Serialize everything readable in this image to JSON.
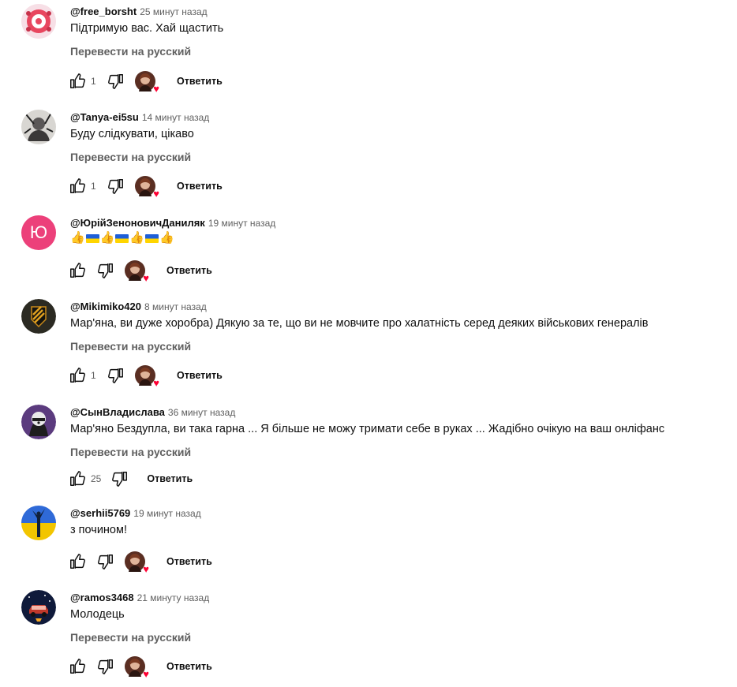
{
  "colors": {
    "text": "#0f0f0f",
    "secondary": "#606060",
    "heart": "#ff0033",
    "letter_avatar_bg": "#ec407a"
  },
  "reply_label": "Ответить",
  "translate_label": "Перевести на русский",
  "comments": [
    {
      "author": "@free_borsht",
      "time": "25 минут назад",
      "text": "Підтримую вас. Хай щастить",
      "likes": "1",
      "translate": true,
      "avatar_icon": "pink-roses-icon"
    },
    {
      "author": "@Tanya-ei5su",
      "time": "14 минут назад",
      "text": "Буду слідкувати, цікаво",
      "likes": "1",
      "translate": true,
      "avatar_icon": "sketch-portrait-icon"
    },
    {
      "author": "@ЮрійЗеноновичДаниляк",
      "time": "19 минут назад",
      "text": "",
      "likes": "",
      "translate": false,
      "avatar_letter": "Ю",
      "emoji_sequence": [
        "thumbs-up",
        "ukraine-flag",
        "thumbs-up",
        "ukraine-flag",
        "thumbs-up",
        "ukraine-flag",
        "thumbs-up"
      ]
    },
    {
      "author": "@Mikimiko420",
      "time": "8 минут назад",
      "text": "Мар'яна, ви дуже хоробра) Дякую за те, що ви не мовчите про халатність серед деяких військових генералів",
      "likes": "1",
      "translate": true,
      "avatar_icon": "military-chevron-icon"
    },
    {
      "author": "@СынВладислава",
      "time": "36 минут назад",
      "text": "Мар'яно Бездупла, ви така гарна ... Я більше не можу тримати себе в руках ... Жадібно очікую на ваш онліфанс",
      "likes": "25",
      "translate": true,
      "avatar_icon": "raccoon-icon"
    },
    {
      "author": "@serhii5769",
      "time": "19 минут назад",
      "text": "з почином!",
      "likes": "",
      "translate": false,
      "avatar_icon": "motherland-statue-icon"
    },
    {
      "author": "@ramos3468",
      "time": "21 минуту назад",
      "text": "Молодець",
      "likes": "",
      "translate": true,
      "avatar_icon": "night-car-icon"
    }
  ]
}
